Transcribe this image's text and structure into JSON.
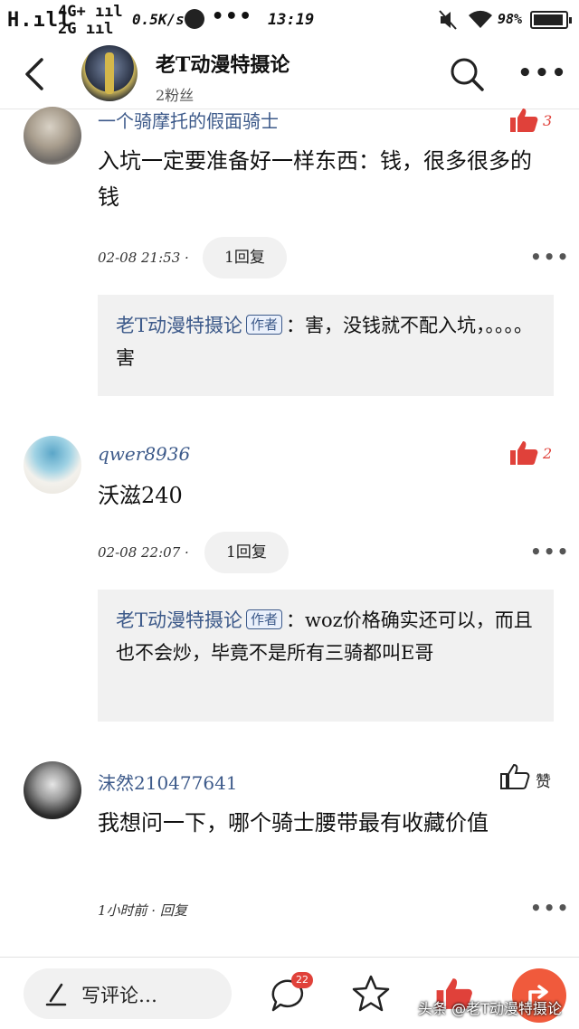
{
  "status_bar": {
    "carrier": "H.ıll",
    "network_top": "4G+ ııl",
    "network_bottom": "2G ııl",
    "speed": "0.5K/s",
    "dots": "•••",
    "time": "13:19",
    "battery": "98%"
  },
  "header": {
    "name": "老T动漫特摄论",
    "fans": "2粉丝",
    "more_label": "•••"
  },
  "comments": [
    {
      "name": "一个骑摩托的假面骑士",
      "like_count": "3",
      "text": "入坑一定要准备好一样东西：钱，很多很多的钱",
      "time": "02-08 21:53 ·",
      "reply_pill": "1回复",
      "more": "•••",
      "reply": {
        "author": "老T动漫特摄论",
        "badge": "作者",
        "text": "：害，没钱就不配入坑，。。。。害"
      }
    },
    {
      "name": "qwer8936",
      "like_count": "2",
      "text": "沃滋240",
      "time": "02-08 22:07 ·",
      "reply_pill": "1回复",
      "more": "•••",
      "reply": {
        "author": "老T动漫特摄论",
        "badge": "作者",
        "text": "：woz价格确实还可以，而且也不会炒，毕竟不是所有三骑都叫E哥"
      }
    },
    {
      "name": "沫然210477641",
      "like_label": "赞",
      "text": "我想问一下，哪个骑士腰带最有收藏价值",
      "time": "1小时前 · 回复",
      "more": "•••"
    }
  ],
  "bottom_bar": {
    "write_placeholder": "写评论…",
    "comment_count": "22"
  },
  "watermark": "头条 @老T动漫特摄论",
  "colors": {
    "accent_red": "#e0413a",
    "name_blue": "#3d5a8a",
    "reply_bg": "#f1f1f1",
    "share_orange": "#f05a3c"
  }
}
